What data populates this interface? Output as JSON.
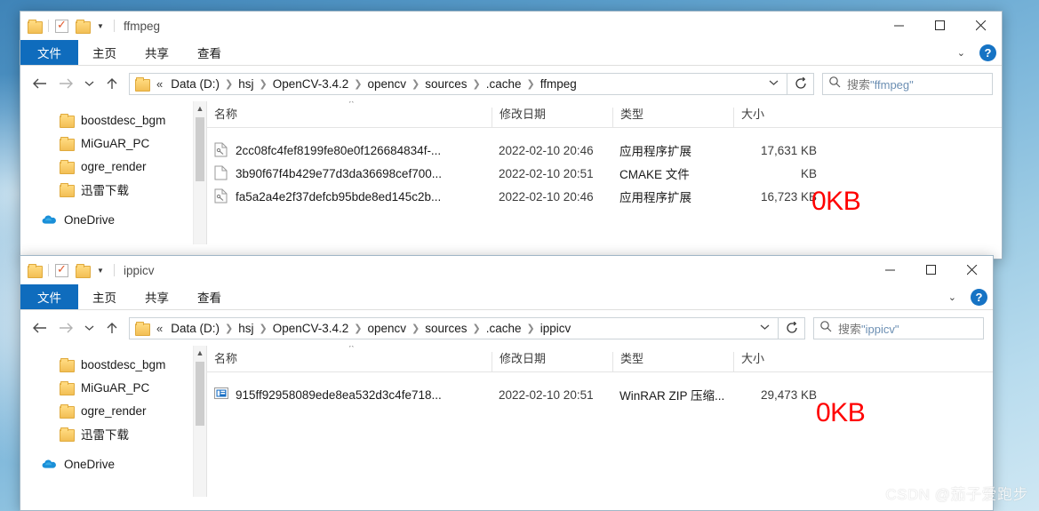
{
  "desktop": {
    "wallpaper_hint": "blue sky with clouds"
  },
  "watermark": {
    "text": "CSDN @茄子爱跑步"
  },
  "window1": {
    "title": "ffmpeg",
    "quick_access": {
      "folder_icon": "folder-icon",
      "properties_icon": "properties-checkbox-icon",
      "new_folder_icon": "new-folder-icon",
      "customize_caret": "chevron-down-icon"
    },
    "controls": {
      "minimize": "minimize-icon",
      "maximize": "maximize-icon",
      "close": "close-icon"
    },
    "ribbon": {
      "tabs": [
        "文件",
        "主页",
        "共享",
        "查看"
      ],
      "expand": "chevron-up-icon",
      "help": "?"
    },
    "nav": {
      "back": "back-arrow-icon",
      "forward": "forward-arrow-icon",
      "recent": "chevron-down-icon",
      "up": "up-arrow-icon",
      "refresh": "refresh-icon",
      "addr_caret": "chevron-down-icon"
    },
    "breadcrumbs": [
      "Data (D:)",
      "hsj",
      "OpenCV-3.4.2",
      "opencv",
      "sources",
      ".cache",
      "ffmpeg"
    ],
    "search": {
      "prefix": "搜索",
      "target": "\"ffmpeg\"",
      "placeholder": "搜索\"ffmpeg\"",
      "icon": "search-icon"
    },
    "sidebar": {
      "items": [
        {
          "label": "boostdesc_bgm",
          "icon": "folder-icon",
          "type": "folder"
        },
        {
          "label": "MiGuAR_PC",
          "icon": "folder-icon",
          "type": "folder"
        },
        {
          "label": "ogre_render",
          "icon": "folder-icon",
          "type": "folder"
        },
        {
          "label": "迅雷下载",
          "icon": "folder-icon",
          "type": "folder"
        },
        {
          "label": "OneDrive",
          "icon": "onedrive-icon",
          "type": "root"
        }
      ],
      "scroll_up_arrow": "chevron-up-icon"
    },
    "columns": [
      "名称",
      "修改日期",
      "类型",
      "大小"
    ],
    "sort_indicator": "^",
    "rows": [
      {
        "name": "2cc08fc4fef8199fe80e0f126684834f-...",
        "date": "2022-02-10 20:46",
        "type": "应用程序扩展",
        "size": "17,631 KB",
        "icon": "dll-file-icon"
      },
      {
        "name": "3b90f67f4b429e77d3da36698cef700...",
        "date": "2022-02-10 20:51",
        "type": "CMAKE 文件",
        "size": "KB",
        "icon": "blank-file-icon"
      },
      {
        "name": "fa5a2a4e2f37defcb95bde8ed145c2b...",
        "date": "2022-02-10 20:46",
        "type": "应用程序扩展",
        "size": "16,723 KB",
        "icon": "dll-file-icon"
      }
    ],
    "annotation": {
      "text": "0KB",
      "color": "#ff0000",
      "target_row": 1
    }
  },
  "window2": {
    "title": "ippicv",
    "quick_access": {
      "folder_icon": "folder-icon",
      "properties_icon": "properties-checkbox-icon",
      "new_folder_icon": "new-folder-icon",
      "customize_caret": "chevron-down-icon"
    },
    "controls": {
      "minimize": "minimize-icon",
      "maximize": "maximize-icon",
      "close": "close-icon"
    },
    "ribbon": {
      "tabs": [
        "文件",
        "主页",
        "共享",
        "查看"
      ],
      "expand": "chevron-up-icon",
      "help": "?"
    },
    "nav": {
      "back": "back-arrow-icon",
      "forward": "forward-arrow-icon",
      "recent": "chevron-down-icon",
      "up": "up-arrow-icon",
      "refresh": "refresh-icon",
      "addr_caret": "chevron-down-icon"
    },
    "breadcrumbs": [
      "Data (D:)",
      "hsj",
      "OpenCV-3.4.2",
      "opencv",
      "sources",
      ".cache",
      "ippicv"
    ],
    "search": {
      "prefix": "搜索",
      "target": "\"ippicv\"",
      "placeholder": "搜索\"ippicv\"",
      "icon": "search-icon"
    },
    "sidebar": {
      "items": [
        {
          "label": "boostdesc_bgm",
          "icon": "folder-icon",
          "type": "folder"
        },
        {
          "label": "MiGuAR_PC",
          "icon": "folder-icon",
          "type": "folder"
        },
        {
          "label": "ogre_render",
          "icon": "folder-icon",
          "type": "folder"
        },
        {
          "label": "迅雷下载",
          "icon": "folder-icon",
          "type": "folder"
        },
        {
          "label": "OneDrive",
          "icon": "onedrive-icon",
          "type": "root"
        }
      ],
      "scroll_up_arrow": "chevron-up-icon"
    },
    "columns": [
      "名称",
      "修改日期",
      "类型",
      "大小"
    ],
    "sort_indicator": "^",
    "rows": [
      {
        "name": "915ff92958089ede8ea532d3c4fe718...",
        "date": "2022-02-10 20:51",
        "type": "WinRAR ZIP 压缩...",
        "size": "29,473 KB",
        "icon": "zip-file-icon"
      }
    ],
    "annotation": {
      "text": "0KB",
      "color": "#ff0000",
      "target_row": 0
    }
  }
}
